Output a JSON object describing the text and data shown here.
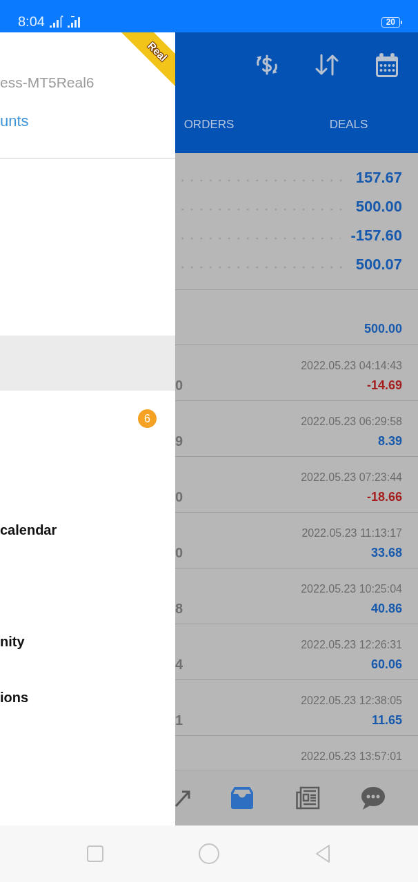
{
  "status_bar": {
    "time": "8:04",
    "battery": "20"
  },
  "drawer": {
    "server": "ess-MT5Real6",
    "ribbon": "Real",
    "link": "unts",
    "items": [
      {
        "selected": true
      },
      {
        "badge": "6",
        "selected": false
      },
      {
        "selected": false
      },
      {
        "label": "calendar",
        "selected": false
      },
      {
        "selected": false
      },
      {
        "label": "nity",
        "selected": false
      },
      {
        "label": "ions",
        "selected": false
      }
    ]
  },
  "tabs": [
    {
      "label": "ORDERS",
      "selected": false
    },
    {
      "label": "DEALS",
      "selected": false
    }
  ],
  "summary": {
    "rows": [
      "157.67",
      "500.00",
      "-157.60",
      "500.07"
    ],
    "total": "500.00"
  },
  "deals": [
    {
      "column_1": "0",
      "time": "2022.05.23 04:14:43",
      "profit": "-14.69",
      "color": "#a51d1d"
    },
    {
      "column_1": "9",
      "time": "2022.05.23 06:29:58",
      "profit": "8.39",
      "color": "#1659ad"
    },
    {
      "column_1": "0",
      "time": "2022.05.23 07:23:44",
      "profit": "-18.66",
      "color": "#a51d1d"
    },
    {
      "column_1": "0",
      "time": "2022.05.23 11:13:17",
      "profit": "33.68",
      "color": "#1659ad"
    },
    {
      "column_1": "8",
      "time": "2022.05.23 10:25:04",
      "profit": "40.86",
      "color": "#1659ad"
    },
    {
      "column_1": "4",
      "time": "2022.05.23 12:26:31",
      "profit": "60.06",
      "color": "#1659ad"
    },
    {
      "column_1": "1",
      "time": "2022.05.23 12:38:05",
      "profit": "11.65",
      "color": "#1659ad"
    },
    {
      "time": "2022.05.23 13:57:01"
    }
  ],
  "bottom_nav": [
    {
      "kind": "arrow",
      "selected": false
    },
    {
      "kind": "inbox",
      "selected": true
    },
    {
      "kind": "news",
      "selected": false
    },
    {
      "kind": "chat",
      "selected": false
    }
  ]
}
